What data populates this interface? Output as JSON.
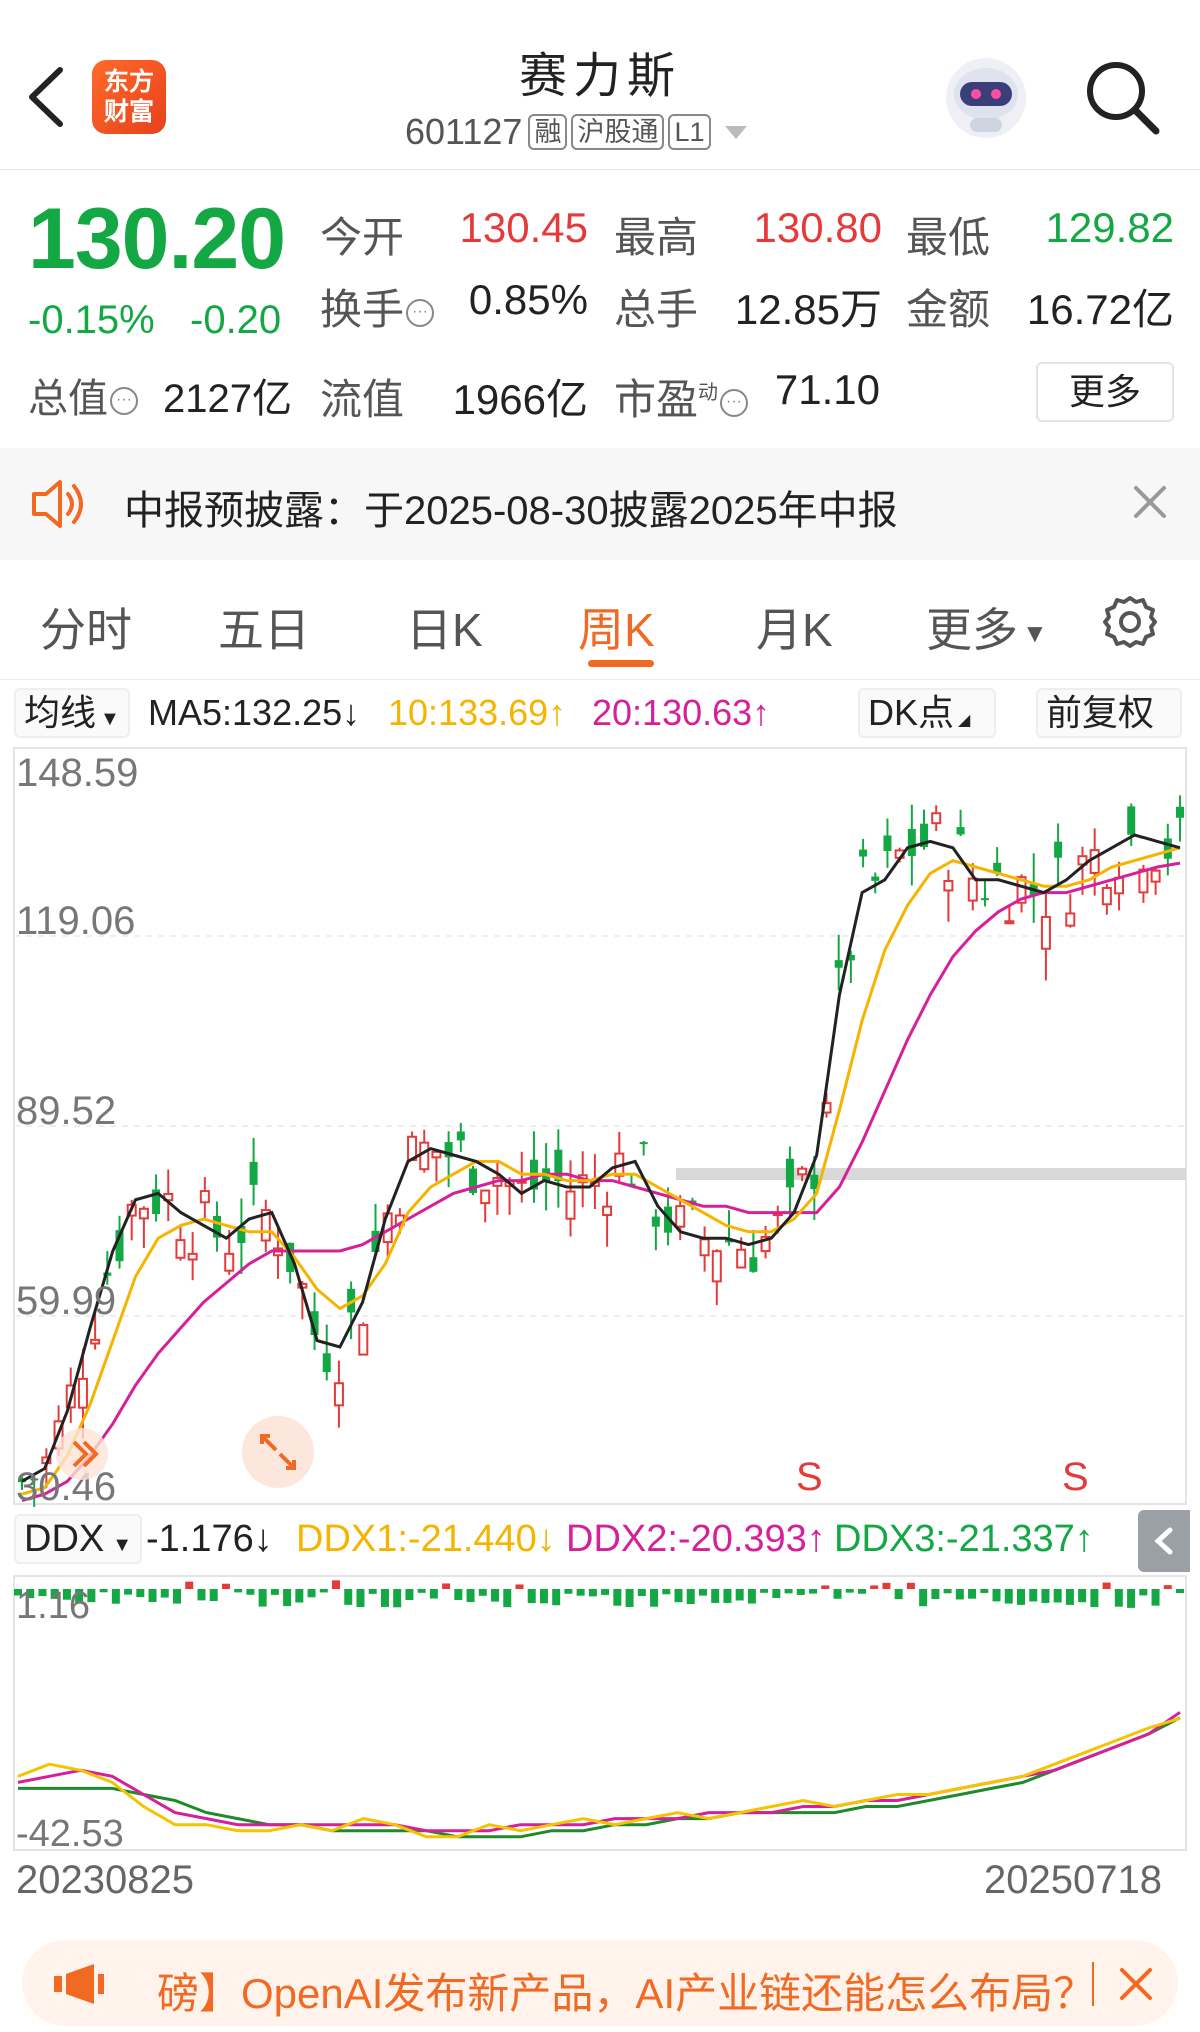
{
  "header": {
    "title": "赛力斯",
    "code": "601127",
    "tags": [
      "融",
      "沪股通",
      "L1"
    ],
    "logo_text": [
      "东方",
      "财富"
    ]
  },
  "quote": {
    "price": "130.20",
    "change_pct": "-0.15%",
    "change": "-0.20",
    "open_label": "今开",
    "open": "130.45",
    "high_label": "最高",
    "high": "130.80",
    "low_label": "最低",
    "low": "129.82",
    "turnover_label": "换手",
    "turnover": "0.85%",
    "volume_label": "总手",
    "volume": "12.85万",
    "amount_label": "金额",
    "amount": "16.72亿",
    "mcap_label": "总值",
    "mcap": "2127亿",
    "float_label": "流值",
    "float_mcap": "1966亿",
    "pe_label": "市盈",
    "pe_sup": "动",
    "pe": "71.10",
    "more_label": "更多",
    "colors": {
      "up": "#e53a3a",
      "down": "#14a844"
    }
  },
  "notice": {
    "text": "中报预披露：于2025-08-30披露2025年中报"
  },
  "tabs": {
    "items": [
      {
        "label": "分时"
      },
      {
        "label": "五日"
      },
      {
        "label": "日K"
      },
      {
        "label": "周K"
      },
      {
        "label": "月K"
      },
      {
        "label": "更多"
      }
    ],
    "active": "周K"
  },
  "indicators": {
    "ma_select": "均线",
    "ma5": "MA5:132.25↓",
    "ma10": "10:133.69↑",
    "ma20": "20:130.63↑",
    "dk": "DK点",
    "adjust": "前复权",
    "ddx_select": "DDX",
    "ddx": "-1.176↓",
    "ddx1": "DDX1:-21.440↓",
    "ddx2": "DDX2:-20.393↑",
    "ddx3": "DDX3:-21.337↑",
    "colors": {
      "ma5": "#222222",
      "ma10": "#f5b400",
      "ma20": "#d6209a",
      "ddx3": "#14a844"
    }
  },
  "chart_data": [
    {
      "type": "candlestick",
      "title": "周K",
      "y_ticks": [
        "148.59",
        "119.06",
        "89.52",
        "59.99",
        "30.46"
      ],
      "ylim": [
        30.46,
        148.59
      ],
      "x_start": "20230825",
      "x_end": "20250718",
      "annotations": [
        "S",
        "S"
      ],
      "series": [
        {
          "name": "MA5",
          "values": [
            34,
            36,
            45,
            58,
            70,
            78,
            79,
            76,
            74,
            72,
            75,
            76,
            68,
            56,
            55,
            62,
            75,
            84,
            86,
            85,
            84,
            82,
            79,
            81,
            80,
            80,
            83,
            84,
            77,
            73,
            72,
            72,
            71,
            72,
            76,
            85,
            110,
            126,
            128,
            133,
            134,
            133,
            128,
            128,
            127,
            126,
            128,
            131,
            133,
            135,
            134,
            133
          ]
        },
        {
          "name": "MA10",
          "values": [
            32,
            33,
            38,
            46,
            56,
            66,
            72,
            74,
            75,
            74,
            73,
            73,
            69,
            64,
            61,
            63,
            68,
            76,
            80,
            82,
            84,
            84,
            82,
            82,
            81,
            81,
            82,
            82,
            80,
            78,
            76,
            74,
            73,
            73,
            75,
            79,
            92,
            106,
            117,
            124,
            129,
            131,
            130,
            129,
            128,
            127,
            127,
            128,
            130,
            131,
            132,
            133
          ]
        },
        {
          "name": "MA20",
          "values": [
            31,
            32,
            34,
            38,
            43,
            49,
            54,
            58,
            62,
            65,
            68,
            70,
            70,
            70,
            70,
            71,
            73,
            75,
            77,
            79,
            80,
            81,
            81,
            82,
            82,
            81,
            81,
            80,
            79,
            78,
            77,
            77,
            76,
            76,
            76,
            76,
            80,
            87,
            95,
            103,
            110,
            116,
            120,
            123,
            125,
            126,
            126,
            127,
            128,
            129,
            130,
            130.6
          ]
        }
      ]
    },
    {
      "type": "line",
      "title": "DDX",
      "y_ticks": [
        "1.16",
        "-42.53"
      ],
      "ylim": [
        -42.53,
        1.16
      ],
      "series": [
        {
          "name": "DDX1",
          "values": [
            -31,
            -29,
            -30,
            -32,
            -36,
            -39,
            -39,
            -40,
            -40,
            -39,
            -40,
            -38,
            -39,
            -41,
            -41,
            -39,
            -40,
            -39,
            -38,
            -39,
            -38,
            -37,
            -38,
            -37,
            -36,
            -35,
            -36,
            -35,
            -34,
            -34,
            -33,
            -32,
            -31,
            -29,
            -27,
            -25,
            -23,
            -21.4
          ]
        },
        {
          "name": "DDX2",
          "values": [
            -32,
            -31,
            -30,
            -31,
            -34,
            -37,
            -38,
            -39,
            -39,
            -39,
            -39,
            -39,
            -39,
            -40,
            -40,
            -40,
            -39,
            -39,
            -39,
            -38,
            -38,
            -38,
            -37,
            -37,
            -37,
            -36,
            -36,
            -35,
            -35,
            -34,
            -33,
            -32,
            -31,
            -30,
            -28,
            -26,
            -24,
            -20.4
          ]
        },
        {
          "name": "DDX3",
          "values": [
            -33,
            -33,
            -33,
            -33,
            -34,
            -35,
            -37,
            -38,
            -39,
            -39,
            -40,
            -40,
            -40,
            -40,
            -41,
            -41,
            -41,
            -40,
            -40,
            -39,
            -39,
            -38,
            -38,
            -37,
            -37,
            -37,
            -37,
            -36,
            -36,
            -35,
            -34,
            -33,
            -32,
            -30,
            -28,
            -26,
            -24,
            -21.3
          ]
        }
      ]
    }
  ],
  "ticker": {
    "text": "磅】OpenAI发布新产品，AI产业链还能怎么布局？"
  }
}
